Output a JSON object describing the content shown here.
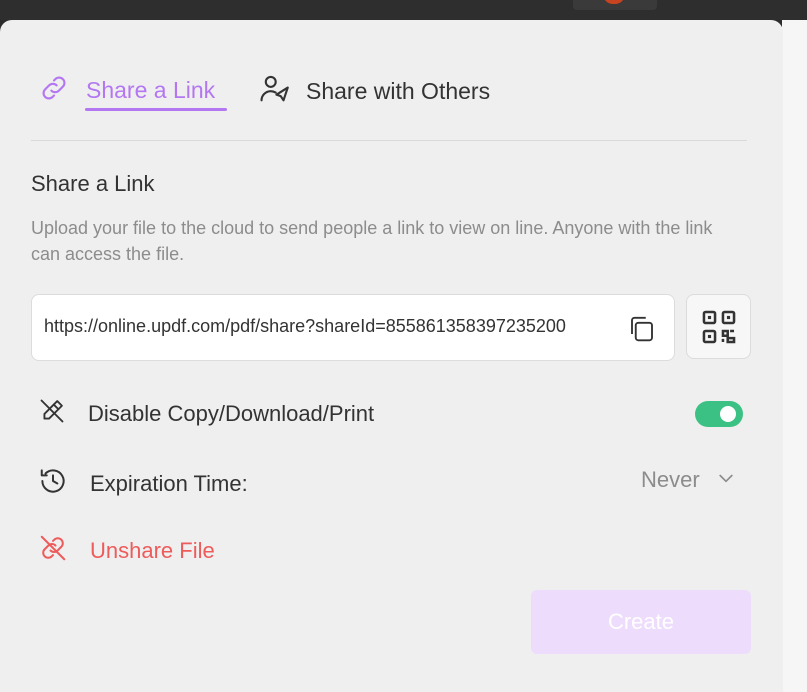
{
  "tabs": {
    "share_link": "Share a Link",
    "share_others": "Share with Others"
  },
  "section": {
    "title": "Share a Link",
    "description": "Upload your file to the cloud to send people a link to view on line. Anyone with the link can access the file."
  },
  "link": {
    "url": "https://online.updf.com/pdf/share?shareId=855861358397235200"
  },
  "options": {
    "disable_label": "Disable Copy/Download/Print",
    "disable_enabled": true,
    "expiration_label": "Expiration Time:",
    "expiration_value": "Never",
    "unshare_label": "Unshare File"
  },
  "actions": {
    "create_label": "Create"
  },
  "colors": {
    "accent": "#b477f2",
    "toggle_on": "#3cc184",
    "danger": "#ee5b5b",
    "create_disabled_bg": "#eedcfd"
  }
}
